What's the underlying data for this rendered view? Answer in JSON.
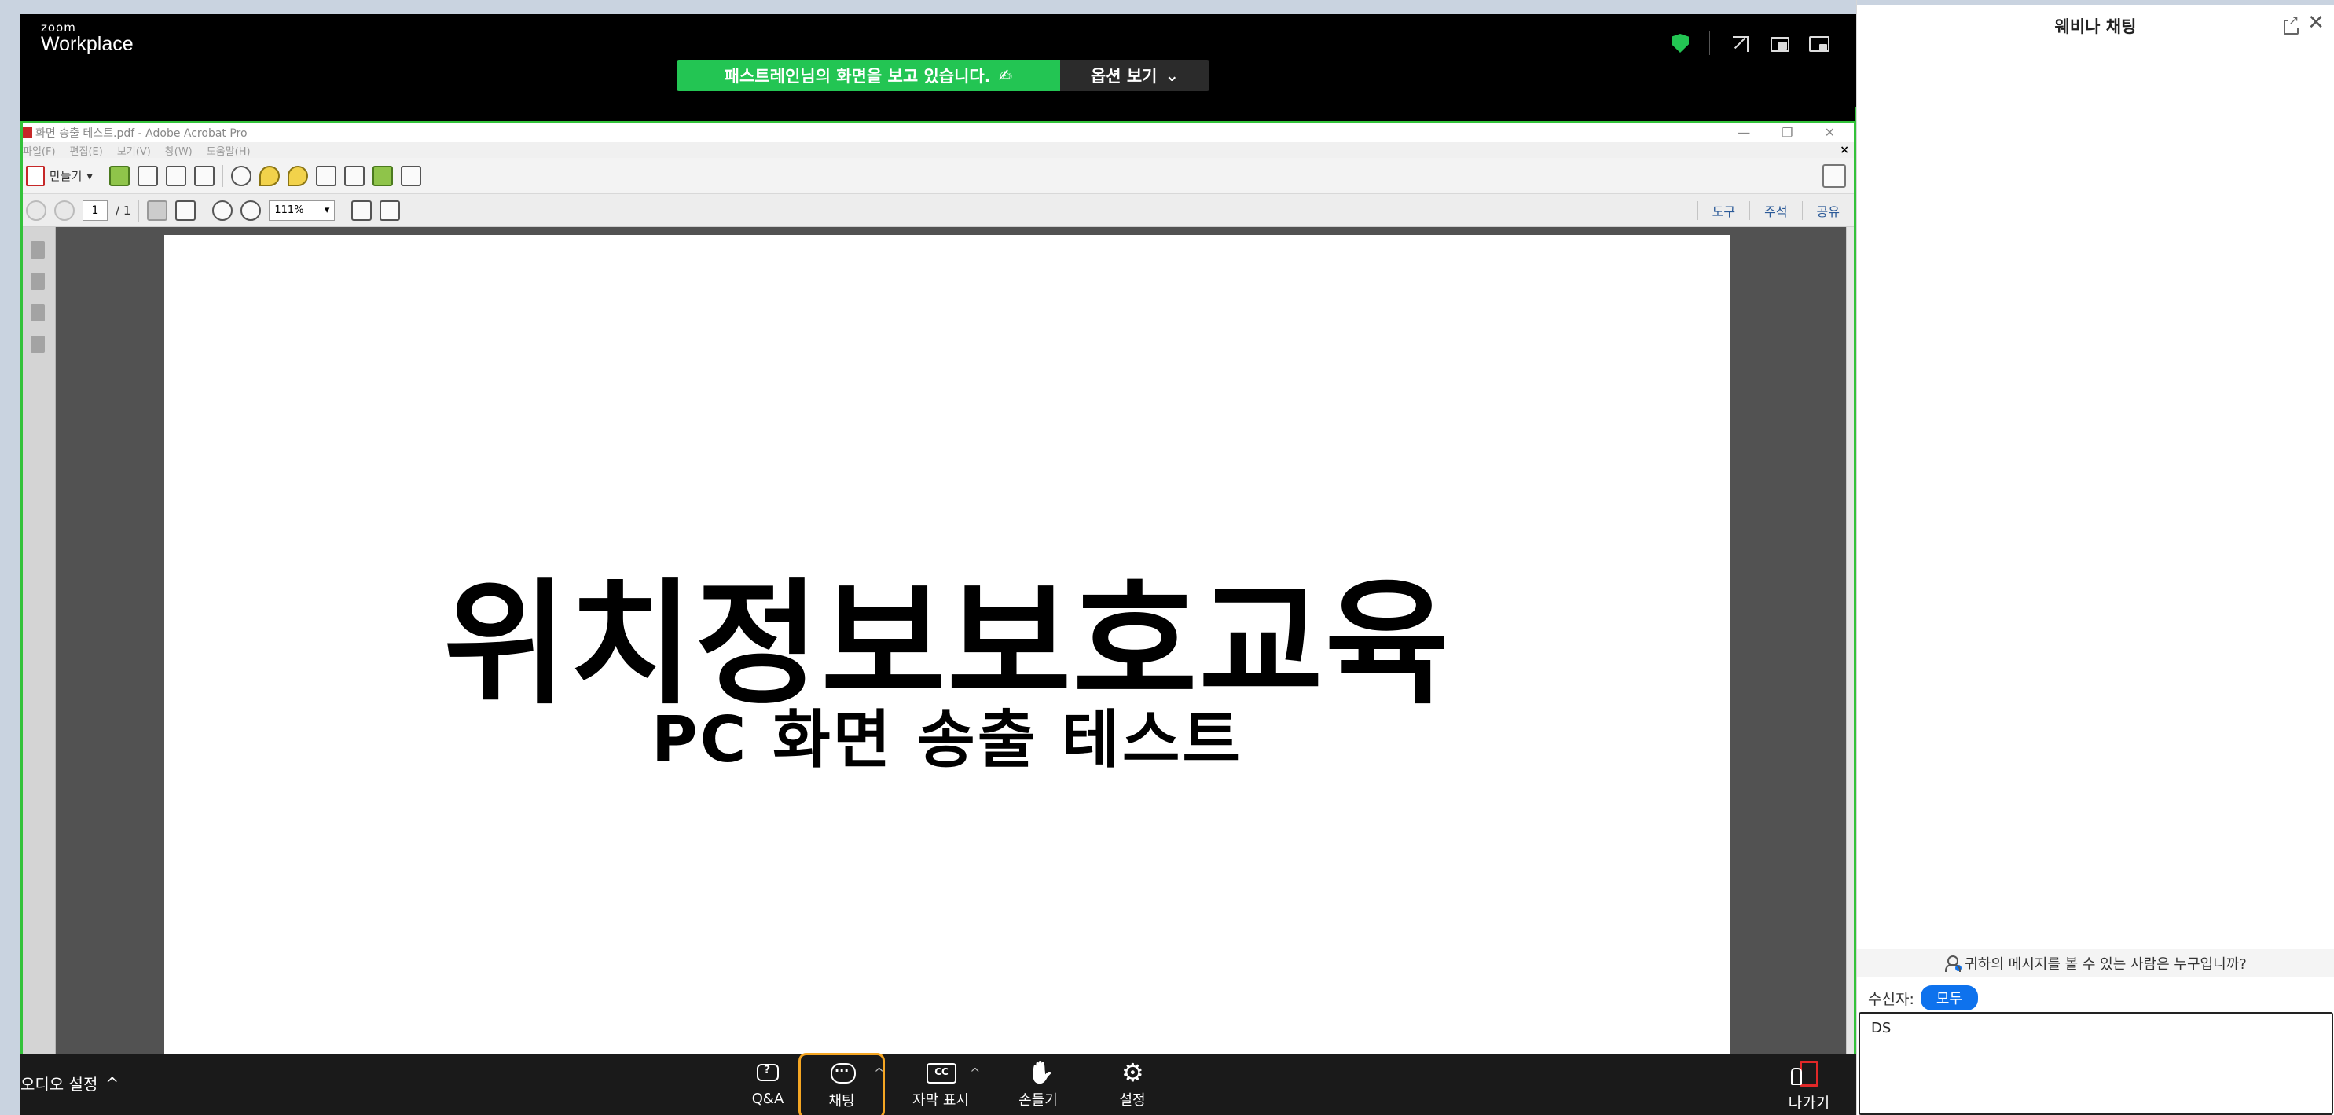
{
  "zoom": {
    "logo_small": "zoom",
    "logo_big": "Workplace",
    "share_banner": "패스트레인님의 화면을 보고 있습니다.",
    "options_label": "옵션 보기",
    "options_caret": "⌄",
    "pen_glyph": "✍"
  },
  "acrobat": {
    "title": "화면 송출 테스트.pdf - Adobe Acrobat Pro",
    "win_controls": [
      "—",
      "❐",
      "✕"
    ],
    "menu": [
      "파일(F)",
      "편집(E)",
      "보기(V)",
      "창(W)",
      "도움말(H)"
    ],
    "menu_close": "×",
    "create_label": "만들기",
    "create_caret": "▾",
    "page_current": "1",
    "page_total": "/ 1",
    "zoom_level": "111%",
    "zoom_caret": "▾",
    "right_links": [
      "도구",
      "주석",
      "공유"
    ]
  },
  "pdf": {
    "title": "위치정보보호교육",
    "subtitle": "PC 화면 송출 테스트"
  },
  "bottombar": {
    "audio_label": "오디오 설정",
    "caret": "^",
    "qa_label": "Q&A",
    "chat_label": "채팅",
    "cc_label": "자막 표시",
    "hand_label": "손들기",
    "settings_label": "설정",
    "leave_label": "나가기"
  },
  "chat_panel": {
    "title": "웨비나 채팅",
    "close_glyph": "✕",
    "who_can_see": "귀하의 메시지를 볼 수 있는 사람은 누구입니까?",
    "recipient_label": "수신자:",
    "recipient_value": "모두",
    "input_value": "DS"
  },
  "colors": {
    "share_green": "#23c553",
    "border_green": "#33c23a",
    "chat_highlight": "#f5a623",
    "recipient_blue": "#0e72ed",
    "leave_red": "#e02828"
  }
}
